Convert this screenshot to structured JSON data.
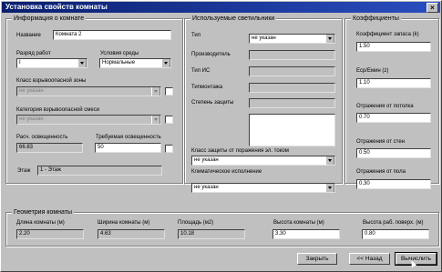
{
  "window": {
    "title": "Установка свойств комнаты",
    "close_glyph": "×"
  },
  "room_info": {
    "title": "Информация о комнате",
    "name_label": "Название",
    "name_value": "Комната 2",
    "work_class_label": "Разряд работ",
    "work_class_value": "I",
    "env_label": "Условия среды",
    "env_value": "Нормальные",
    "explosion_class_label": "Класс взрывоопасной зоны",
    "explosion_class_value": "не указан",
    "mixture_label": "Категория взрывоопасной смеси",
    "mixture_value": "не указан",
    "calc_light_label": "Расч. освещенность",
    "calc_light_value": "66.83",
    "req_light_label": "Требуемая освещенность",
    "req_light_value": "50",
    "floor_label": "Этаж",
    "floor_value": "1 - Этаж"
  },
  "fixtures": {
    "title": "Используемые светильники",
    "type_label": "Тип",
    "type_value": "не указан",
    "maker_label": "Производитель",
    "lamp_type_label": "Тип ИС",
    "mounting_label": "Типмонтажа",
    "protection_label": "Степень защиты",
    "shock_class_label": "Класс защиты от поражения эл. током",
    "shock_class_value": "не указан",
    "climate_label": "Климатическое исполнение",
    "climate_value": "не указан"
  },
  "coefficients": {
    "title": "Коэффициенты",
    "reserve_label": "Коэффициент запаса (k)",
    "reserve_value": "1.50",
    "ratio_label": "Еср/Емин (z)",
    "ratio_value": "1.10",
    "ceiling_label": "Отражения от потолка",
    "ceiling_value": "0.70",
    "walls_label": "Отражения от стен",
    "walls_value": "0.50",
    "floor_label": "Отражения от пола",
    "floor_value": "0.30"
  },
  "geometry": {
    "title": "Геометрия комнаты",
    "length_label": "Длина комнаты (м)",
    "length_value": "2.20",
    "width_label": "Ширина комнаты (м)",
    "width_value": "4.63",
    "area_label": "Площадь (м2)",
    "area_value": "10.18",
    "height_label": "Высота комнаты (м)",
    "height_value": "3.30",
    "work_height_label": "Высота раб. поверх. (м)",
    "work_height_value": "0.80"
  },
  "buttons": {
    "close": "Закрыть",
    "back": "<< Назад",
    "calculate": "Вычислить"
  }
}
